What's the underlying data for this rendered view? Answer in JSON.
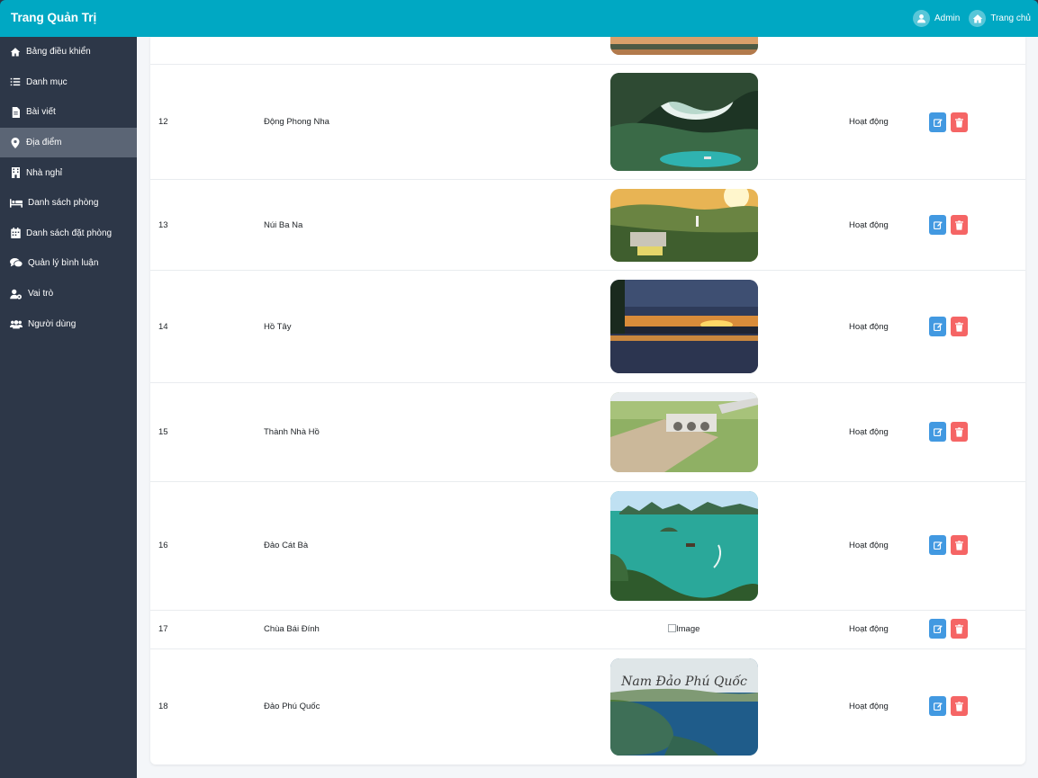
{
  "header": {
    "title": "Trang Quản Trị",
    "admin_label": "Admin",
    "home_label": "Trang chủ"
  },
  "sidebar": {
    "items": [
      {
        "label": "Bảng điều khiển",
        "icon": "home-icon"
      },
      {
        "label": "Danh mục",
        "icon": "list-icon"
      },
      {
        "label": "Bài viết",
        "icon": "file-icon"
      },
      {
        "label": "Địa điểm",
        "icon": "map-marker-icon",
        "active": true
      },
      {
        "label": "Nhà nghỉ",
        "icon": "building-icon"
      },
      {
        "label": "Danh sách phòng",
        "icon": "bed-icon"
      },
      {
        "label": "Danh sách đặt phòng",
        "icon": "calendar-icon"
      },
      {
        "label": "Quản lý bình luận",
        "icon": "comments-icon"
      },
      {
        "label": "Vai trò",
        "icon": "user-cog-icon"
      },
      {
        "label": "Người dùng",
        "icon": "users-icon"
      }
    ]
  },
  "table": {
    "rows": [
      {
        "id": "12",
        "name": "Động Phong Nha",
        "status": "Hoạt động",
        "image": "cave"
      },
      {
        "id": "13",
        "name": "Núi Ba Na",
        "status": "Hoạt động",
        "image": "mountain"
      },
      {
        "id": "14",
        "name": "Hồ Tây",
        "status": "Hoạt động",
        "image": "lake"
      },
      {
        "id": "15",
        "name": "Thành Nhà Hồ",
        "status": "Hoạt động",
        "image": "citadel"
      },
      {
        "id": "16",
        "name": "Đảo Cát Bà",
        "status": "Hoạt động",
        "image": "bay"
      },
      {
        "id": "17",
        "name": "Chùa Bái Đính",
        "status": "Hoạt động",
        "image_alt": "Image"
      },
      {
        "id": "18",
        "name": "Đảo Phú Quốc",
        "status": "Hoạt động",
        "image": "island",
        "image_caption": "Nam Đảo Phú Quốc"
      }
    ]
  },
  "colors": {
    "header": "#00a8c3",
    "sidebar": "#2d3748",
    "sidebar_active": "#5b6575",
    "edit_button": "#4299e1",
    "delete_button": "#f56565"
  }
}
